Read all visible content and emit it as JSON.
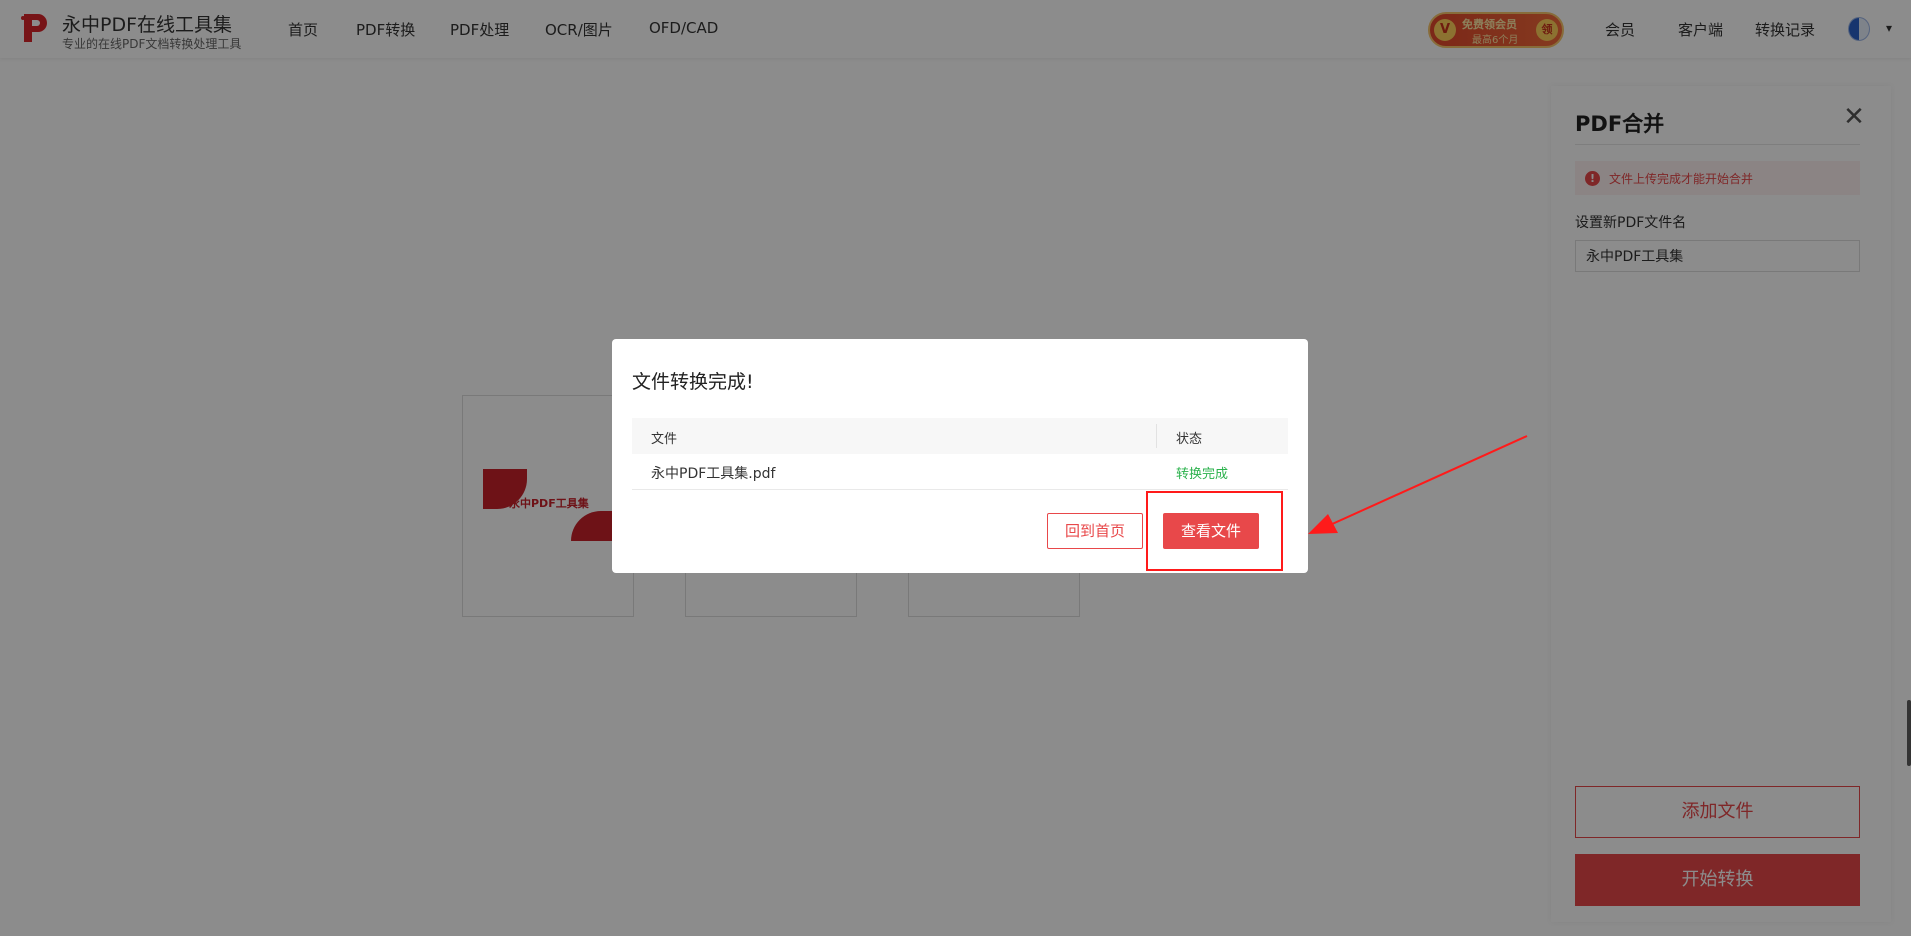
{
  "header": {
    "brand_name": "永中PDF在线工具集",
    "brand_sub": "专业的在线PDF文档转换处理工具",
    "nav": [
      "首页",
      "PDF转换",
      "PDF处理",
      "OCR/图片",
      "OFD/CAD"
    ],
    "promo_line1": "免费领会员",
    "promo_line2": "最高6个月",
    "promo_v": "V",
    "promo_coin": "领",
    "links": [
      "会员",
      "客户端",
      "转换记录"
    ],
    "avatar_caret": "▾"
  },
  "stage": {
    "thumb_title": "永中PDF工具集"
  },
  "panel": {
    "title": "PDF合并",
    "close": "✕",
    "alert_icon": "!",
    "alert_text": "文件上传完成才能开始合并",
    "name_label": "设置新PDF文件名",
    "name_value": "永中PDF工具集",
    "add_button": "添加文件",
    "start_button": "开始转换"
  },
  "dialog": {
    "title": "文件转换完成!",
    "columns": [
      "文件",
      "状态"
    ],
    "rows": [
      {
        "file": "永中PDF工具集.pdf",
        "status": "转换完成"
      }
    ],
    "home_button": "回到首页",
    "view_button": "查看文件"
  },
  "colors": {
    "accent": "#e8484a",
    "success": "#2bb24c",
    "annotation": "#ff1a1a"
  }
}
